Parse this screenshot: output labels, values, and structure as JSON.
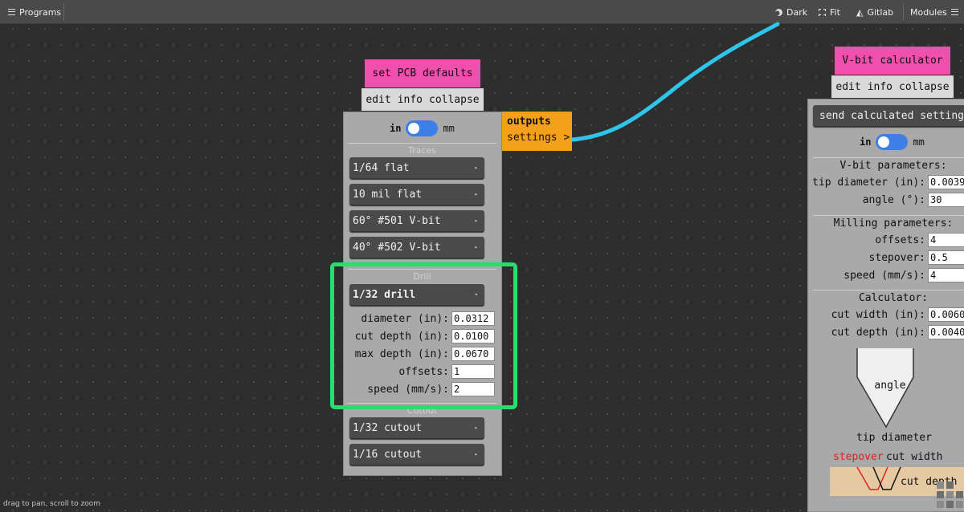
{
  "topbar": {
    "programs_label": "Programs",
    "dark_label": "Dark",
    "fit_label": "Fit",
    "gitlab_label": "Gitlab",
    "modules_label": "Modules"
  },
  "pcb_module": {
    "title": "set PCB defaults",
    "tabs": [
      "edit",
      "info",
      "collapse"
    ],
    "unit_left": "in",
    "unit_right": "mm",
    "traces_label": "Traces",
    "traces": [
      "1/64 flat",
      "10 mil flat",
      "60° #501 V-bit",
      "40° #502 V-bit"
    ],
    "drill_label": "Drill",
    "drill_selected": "1/32 drill",
    "drill_params": [
      {
        "label": "diameter (in):",
        "value": "0.0312"
      },
      {
        "label": "cut depth (in):",
        "value": "0.0100"
      },
      {
        "label": "max depth (in):",
        "value": "0.0670"
      },
      {
        "label": "offsets:",
        "value": "1"
      },
      {
        "label": "speed (mm/s):",
        "value": "2"
      }
    ],
    "cutout_label": "Cutout",
    "cutouts": [
      "1/32 cutout",
      "1/16 cutout"
    ],
    "outputs_title": "outputs",
    "outputs_item": "settings >"
  },
  "vbit_module": {
    "title": "V-bit calculator",
    "tabs": [
      "edit",
      "info",
      "collapse"
    ],
    "send_label": "send calculated settings",
    "unit_left": "in",
    "unit_right": "mm",
    "vbit_params_label": "V-bit parameters:",
    "tip_label": "tip diameter (in):",
    "tip_value": "0.0039",
    "angle_label": "angle (°):",
    "angle_value": "30",
    "milling_label": "Milling parameters:",
    "offsets_label": "offsets:",
    "offsets_value": "4",
    "stepover_label": "stepover:",
    "stepover_value": "0.5",
    "speed_label": "speed (mm/s):",
    "speed_value": "4",
    "calculator_label": "Calculator:",
    "cut_width_label": "cut width (in):",
    "cut_width_value": "0.0060",
    "cut_depth_label": "cut depth (in):",
    "cut_depth_value": "0.0040",
    "diagram_angle": "angle",
    "diagram_tip": "tip diameter",
    "diagram_stepover": "stepover",
    "diagram_cut_width": "cut width",
    "diagram_cut_depth": "cut depth"
  },
  "status_text": "drag to pan, scroll to zoom",
  "colors": {
    "module_title": "#f04fae",
    "outputs": "#f5a01a",
    "wire": "#2fc4e8",
    "highlight": "#22e06a",
    "toggle": "#3d7fe6"
  }
}
